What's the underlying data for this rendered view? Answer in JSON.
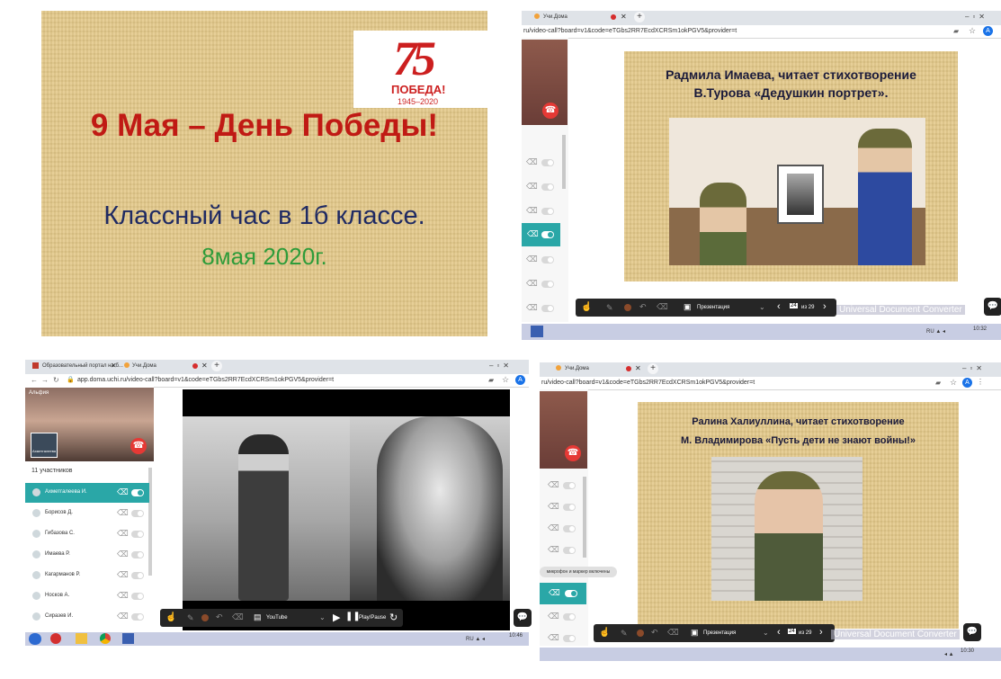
{
  "slide1": {
    "logo_number": "75",
    "logo_text": "ПОБЕДА!",
    "logo_years": "1945–2020",
    "title": "9 Мая – День Победы!",
    "subtitle": "Классный час в 1б классе.",
    "date": "8мая 2020г."
  },
  "panel2": {
    "tab_label": "Учи.Дома",
    "url": "ru/video-call?board=v1&code=eTGbs2RR7EcdXCRSm1okPGV5&provider=t",
    "slide_line1": "Радмила Имаева, читает стихотворение",
    "slide_line2": "В.Турова «Дедушкин портрет».",
    "toolbar": {
      "mode_label": "Презентация",
      "page": "24",
      "of_label": "из 29"
    },
    "watermark": "Universal Document Converter",
    "clock": "10:32"
  },
  "panel3": {
    "tabs": [
      {
        "label": "Образовательный портал на б..."
      },
      {
        "label": "Учи.Дома"
      }
    ],
    "url": "app.doma.uchi.ru/video-call?board=v1&code=eTGbs2RR7EcdXCRSm1okPGV5&provider=t",
    "speaker_name": "Альфия",
    "self_label": "Ахметгалеева",
    "participants_count": "11 участников",
    "participants": [
      {
        "name": "Ахметгалеева И."
      },
      {
        "name": "Борисов Д."
      },
      {
        "name": "Гибазова С."
      },
      {
        "name": "Имаева Р."
      },
      {
        "name": "Кагарманов Р."
      },
      {
        "name": "Носков А."
      },
      {
        "name": "Сиразев И."
      }
    ],
    "toolbar": {
      "mode_label": "YouTube",
      "play_label": "Play/Pause"
    },
    "clock": "10:46"
  },
  "panel4": {
    "tab_label": "Учи.Дома",
    "url": "ru/video-call?board=v1&code=eTGbs2RR7EcdXCRSm1okPGV5&provider=t",
    "slide_line1": "Ралина Халиуллина, читает стихотворение",
    "slide_line2": "М. Владимирова «Пусть дети не знают войны!»",
    "tooltip": "микрофон и маркер включены",
    "toolbar": {
      "mode_label": "Презентация",
      "page": "24",
      "of_label": "из 29"
    },
    "watermark": "Universal Document Converter",
    "clock": "10:30"
  },
  "colors": {
    "title_red": "#c01a14",
    "subtitle_navy": "#1f2a63",
    "date_green": "#2e9c3a",
    "accent_teal": "#2aa7a7",
    "hangup_red": "#e53935"
  }
}
